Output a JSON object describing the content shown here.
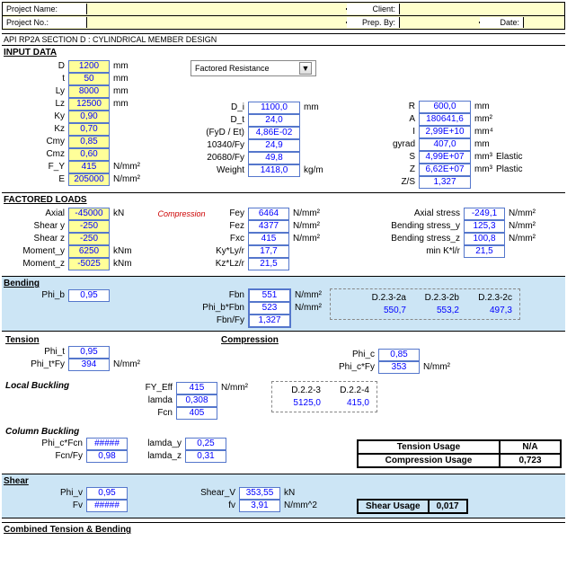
{
  "header": {
    "project_name_label": "Project Name:",
    "project_no_label": "Project No.:",
    "client_label": "Client:",
    "prep_by_label": "Prep. By:",
    "date_label": "Date:"
  },
  "title": "API RP2A SECTION D : CYLINDRICAL MEMBER DESIGN",
  "input_data_label": "INPUT DATA",
  "dropdown": {
    "selected": "Factored Resistance"
  },
  "inputs1": {
    "D": "1200",
    "D_unit": "mm",
    "t": "50",
    "t_unit": "mm",
    "Ly": "8000",
    "Ly_unit": "mm",
    "Lz": "12500",
    "Lz_unit": "mm",
    "Ky": "0,90",
    "Kz": "0,70",
    "Cmy": "0,85",
    "Cmz": "0,60",
    "F_Y": "415",
    "F_Y_unit": "N/mm²",
    "E": "205000",
    "E_unit": "N/mm²"
  },
  "mid": {
    "D_i_label": "D_i",
    "D_i": "1100,0",
    "D_i_unit": "mm",
    "D_t_label": "D_t",
    "D_t": "24,0",
    "FyDoverEt_label": "(FyD / Et)",
    "FyDoverEt": "4,86E-02",
    "k10340_label": "10340/Fy",
    "k10340": "24,9",
    "k20680_label": "20680/Fy",
    "k20680": "49,8",
    "Weight_label": "Weight",
    "Weight": "1418,0",
    "Weight_unit": "kg/m"
  },
  "right": {
    "R_label": "R",
    "R": "600,0",
    "R_unit": "mm",
    "A_label": "A",
    "A": "180641,6",
    "A_unit": "mm²",
    "I_label": "I",
    "I": "2,99E+10",
    "I_unit": "mm⁴",
    "gyrad_label": "gyrad",
    "gyrad": "407,0",
    "gyrad_unit": "mm",
    "S_label": "S",
    "S": "4,99E+07",
    "S_unit": "mm³",
    "S_note": "Elastic",
    "Z_label": "Z",
    "Z": "6,62E+07",
    "Z_unit": "mm³",
    "Z_note": "Plastic",
    "ZS_label": "Z/S",
    "ZS": "1,327"
  },
  "factored_loads_label": "FACTORED LOADS",
  "loads": {
    "Axial": "-45000",
    "Axial_unit": "kN",
    "Axial_note": "Compression",
    "Sheary": "-250",
    "Shearz": "-250",
    "Momenty": "6250",
    "Momenty_unit": "kNm",
    "Momentz": "-5025",
    "Momentz_unit": "kNm"
  },
  "loads_mid": {
    "Fey_label": "Fey",
    "Fey": "6464",
    "Fey_unit": "N/mm²",
    "Fez_label": "Fez",
    "Fez": "4377",
    "Fez_unit": "N/mm²",
    "Fxc_label": "Fxc",
    "Fxc": "415",
    "Fxc_unit": "N/mm²",
    "KyLy_label": "Ky*Ly/r",
    "KyLy": "17,7",
    "KzLz_label": "Kz*Lz/r",
    "KzLz": "21,5"
  },
  "loads_right": {
    "Axial_stress_label": "Axial stress",
    "Axial_stress": "-249,1",
    "unit": "N/mm²",
    "Bsy_label": "Bending stress_y",
    "Bsy": "125,3",
    "Bsz_label": "Bending stress_z",
    "Bsz": "100,8",
    "minK_label": "min K*l/r",
    "minK": "21,5"
  },
  "bending": {
    "title": "Bending",
    "Phi_b_label": "Phi_b",
    "Phi_b": "0,95",
    "Fbn_label": "Fbn",
    "Fbn": "551",
    "unit": "N/mm²",
    "PbFbn_label": "Phi_b*Fbn",
    "PbFbn": "523",
    "FbnFy_label": "Fbn/Fy",
    "FbnFy": "1,327",
    "D232a_label": "D.2.3-2a",
    "D232b_label": "D.2.3-2b",
    "D232c_label": "D.2.3-2c",
    "D232a": "550,7",
    "D232b": "553,2",
    "D232c": "497,3"
  },
  "tension": {
    "title": "Tension",
    "Phi_t_label": "Phi_t",
    "Phi_t": "0,95",
    "PtFy_label": "Phi_t*Fy",
    "PtFy": "394",
    "unit": "N/mm²"
  },
  "compression": {
    "title": "Compression",
    "Phi_c_label": "Phi_c",
    "Phi_c": "0,85",
    "PcFy_label": "Phi_c*Fy",
    "PcFy": "353",
    "unit": "N/mm²"
  },
  "local_buckling": {
    "title": "Local Buckling",
    "FY_Eff_label": "FY_Eff",
    "FY_Eff": "415",
    "unit": "N/mm²",
    "lamda_label": "lamda",
    "lamda": "0,308",
    "Fcn_label": "Fcn",
    "Fcn": "405",
    "D223_label": "D.2.2-3",
    "D224_label": "D.2.2-4",
    "D223": "5125,0",
    "D224": "415,0"
  },
  "column_buckling": {
    "title": "Column Buckling",
    "PcFcn_label": "Phi_c*Fcn",
    "PcFcn": "#####",
    "FcnFy_label": "Fcn/Fy",
    "FcnFy": "0,98",
    "lamday_label": "lamda_y",
    "lamday": "0,25",
    "lamdaz_label": "lamda_z",
    "lamdaz": "0,31"
  },
  "usage": {
    "tension_label": "Tension Usage",
    "tension": "N/A",
    "compression_label": "Compression Usage",
    "compression": "0,723"
  },
  "shear": {
    "title": "Shear",
    "Phi_v_label": "Phi_v",
    "Phi_v": "0,95",
    "Fv_label": "Fv",
    "Fv": "#####",
    "ShearV_label": "Shear_V",
    "ShearV": "353,55",
    "ShearV_unit": "kN",
    "fv_label": "fv",
    "fv": "3,91",
    "fv_unit": "N/mm^2",
    "usage_label": "Shear Usage",
    "usage": "0,017"
  },
  "combined_label": "Combined Tension & Bending"
}
